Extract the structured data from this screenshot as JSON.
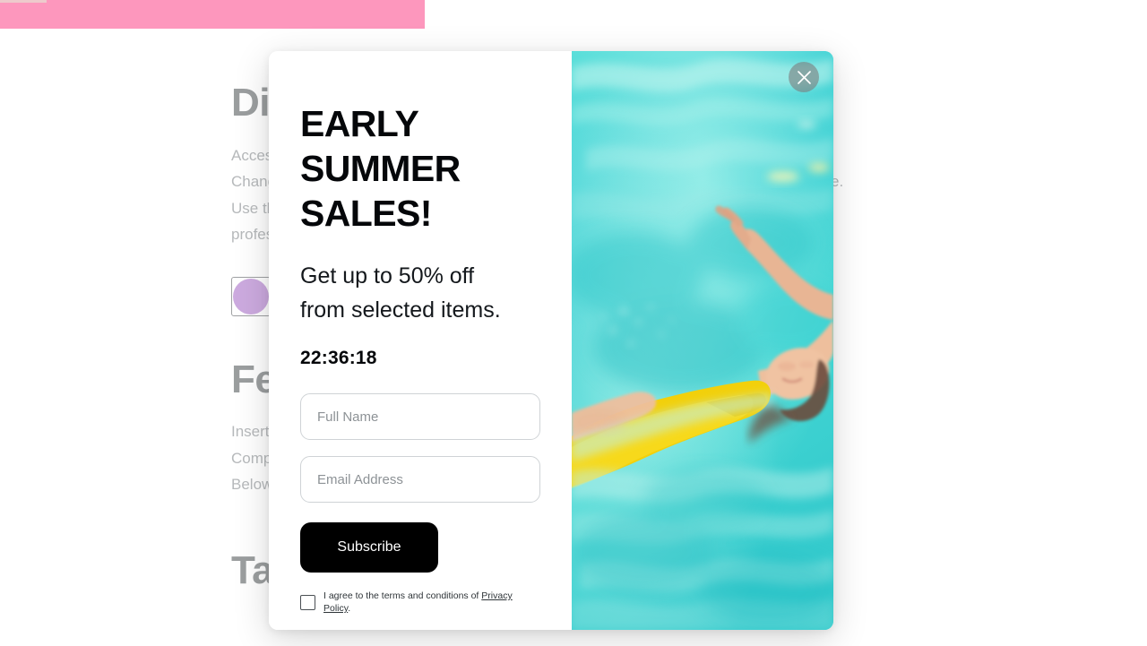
{
  "background": {
    "banner": {
      "color": "#fa1a6e",
      "sliver_color": "#d98a8f"
    },
    "sections": [
      {
        "heading": "Display Settings",
        "paragraph": "Access the display configuration panel to adjust brightness, contrast and color correction. Changes are applied immediately across all connected monitors and saved for your profile. Use the calibration wizard for precise color matching and accurate white balance on professional-grade panels and external displays.",
        "swatch_color": "#8e44b8"
      },
      {
        "heading": "Features",
        "paragraph": "Insert a new block from the library and drop it anywhere on the canvas to begin. Components snap to the underlying grid automatically for consistent spacing everywhere. Below each block you can adjust padding, alignment, background and overall size."
      },
      {
        "heading": "Tags"
      }
    ]
  },
  "modal": {
    "title": "EARLY\nSUMMER\nSALES!",
    "subtitle": "Get up to 50% off\nfrom selected items.",
    "timer": "22:36:18",
    "fields": [
      {
        "name": "full-name",
        "placeholder": "Full Name",
        "value": ""
      },
      {
        "name": "email-address",
        "placeholder": "Email Address",
        "value": ""
      }
    ],
    "subscribe_label": "Subscribe",
    "consent": {
      "text": "I agree to the terms and conditions of ",
      "link_label": "Privacy Policy",
      "suffix": ".",
      "checked": false
    },
    "close_icon": "close-icon",
    "image": {
      "description": "Woman in yellow swimsuit floating in turquoise pool water",
      "water_color": "#3fd6d4",
      "swimsuit_color": "#f2d00b"
    }
  }
}
